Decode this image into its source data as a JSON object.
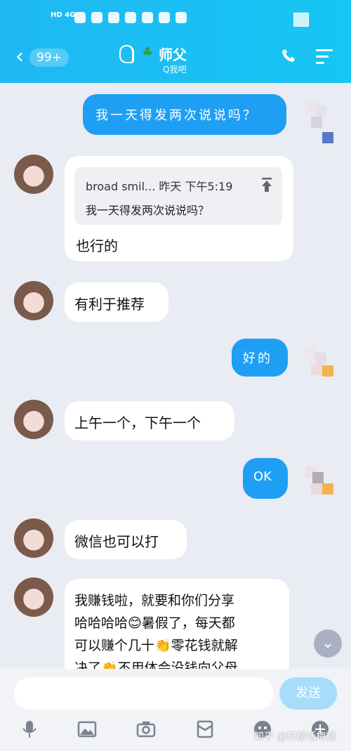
{
  "status_bar": {
    "network": "HD 4G"
  },
  "header": {
    "back_badge": "99+",
    "title": "师父",
    "subtitle": "Q我吧"
  },
  "messages": [
    {
      "side": "right",
      "text": "我一天得发两次说说吗？"
    },
    {
      "side": "left",
      "quote_meta": "broad smil... 昨天 下午5:19",
      "quote_text": "我一天得发两次说说吗？",
      "text": "也行的"
    },
    {
      "side": "left",
      "text": "有利于推荐"
    },
    {
      "side": "right",
      "text": "好的"
    },
    {
      "side": "left",
      "text": "上午一个，下午一个"
    },
    {
      "side": "right",
      "text": "OK"
    },
    {
      "side": "left",
      "text": "微信也可以打"
    },
    {
      "side": "left",
      "line1": "我赚钱啦，就要和你们分享",
      "line2": "哈哈哈哈😊暑假了，每天都",
      "line3": "可以赚个几十👏零花钱就解",
      "line4": "决了👏不用体会没钱向父母"
    }
  ],
  "input": {
    "send_label": "发送"
  },
  "watermark": "知乎 @柠檬话梅糖",
  "colors": {
    "header": "#1fb8f5",
    "bubble_out": "#1e9ff4",
    "background": "#e9ecf3"
  }
}
